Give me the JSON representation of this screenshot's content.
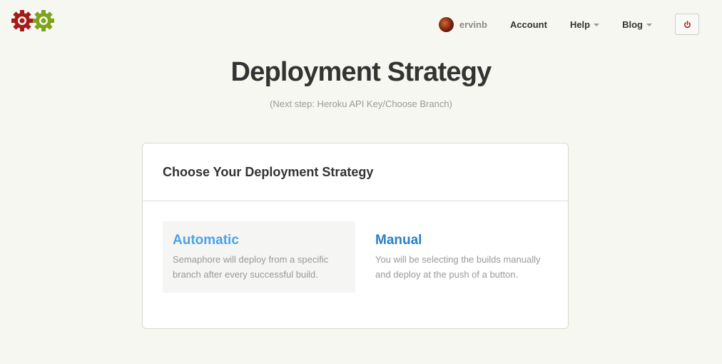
{
  "header": {
    "logo_name": "semaphore-gears-logo",
    "colors": {
      "gear_left": "#a31c1c",
      "gear_right": "#7fa31c"
    },
    "user": {
      "name": "ervinb",
      "avatar": "user-avatar"
    },
    "nav": [
      {
        "label": "Account",
        "dropdown": false
      },
      {
        "label": "Help",
        "dropdown": true
      },
      {
        "label": "Blog",
        "dropdown": true
      }
    ],
    "logout_icon": "power-icon"
  },
  "page": {
    "title": "Deployment Strategy",
    "subtitle": "(Next step: Heroku API Key/Choose Branch)"
  },
  "panel": {
    "title": "Choose Your Deployment Strategy",
    "options": [
      {
        "title": "Automatic",
        "description": "Semaphore will deploy from a specific branch after every successful build.",
        "selected": true,
        "color": "#4aa3e8"
      },
      {
        "title": "Manual",
        "description": "You will be selecting the builds manually and deploy at the push of a button.",
        "selected": false,
        "color": "#2a7fc5"
      }
    ]
  }
}
